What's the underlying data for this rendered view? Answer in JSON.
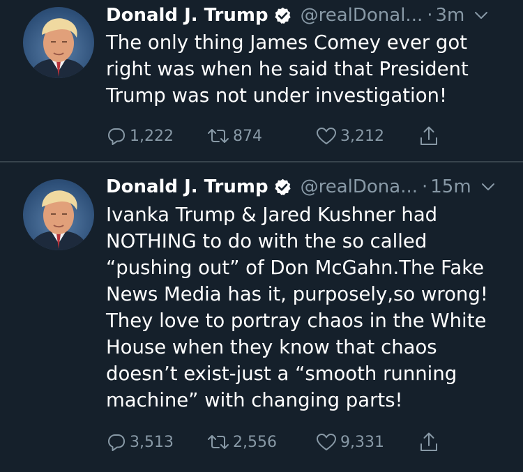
{
  "colors": {
    "background": "#15202b",
    "divider": "#38444d",
    "text": "#ffffff",
    "muted": "#8899a6",
    "verified": "#ffffff"
  },
  "tweets": [
    {
      "name": "Donald J. Trump",
      "handle": "@realDonal...",
      "dot": "·",
      "time": "3m",
      "lines": [
        "The only thing James Comey ever got",
        "right was when he said that President",
        "Trump was not under investigation!"
      ],
      "replies": "1,222",
      "retweets": "874",
      "likes": "3,212",
      "icons": [
        "avatar",
        "verified-icon",
        "chevron-down-icon",
        "reply-icon",
        "retweet-icon",
        "like-icon",
        "share-icon"
      ]
    },
    {
      "name": "Donald J. Trump",
      "handle": "@realDona...",
      "dot": "·",
      "time": "15m",
      "lines": [
        "Ivanka Trump & Jared Kushner had",
        "NOTHING to do with the so called",
        "“pushing out” of Don McGahn.The Fake",
        "News Media has it, purposely,so wrong!",
        "They love to portray chaos in the White",
        "House when they know that chaos",
        "doesn’t exist-just a “smooth running",
        "machine” with changing parts!"
      ],
      "replies": "3,513",
      "retweets": "2,556",
      "likes": "9,331",
      "icons": [
        "avatar",
        "verified-icon",
        "chevron-down-icon",
        "reply-icon",
        "retweet-icon",
        "like-icon",
        "share-icon"
      ]
    }
  ]
}
